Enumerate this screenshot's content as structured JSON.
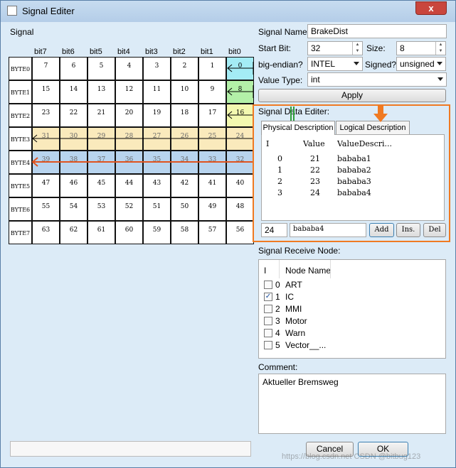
{
  "window": {
    "title": "Signal Editer",
    "close_glyph": "x"
  },
  "signal_group": {
    "label": "Signal"
  },
  "grid": {
    "columns": [
      "bit7",
      "bit6",
      "bit5",
      "bit4",
      "bit3",
      "bit2",
      "bit1",
      "bit0"
    ],
    "rows": [
      {
        "label": "BYTE0",
        "cells": [
          "7",
          "6",
          "5",
          "4",
          "3",
          "2",
          "1",
          "0"
        ]
      },
      {
        "label": "BYTE1",
        "cells": [
          "15",
          "14",
          "13",
          "12",
          "11",
          "10",
          "9",
          "8"
        ]
      },
      {
        "label": "BYTE2",
        "cells": [
          "23",
          "22",
          "21",
          "20",
          "19",
          "18",
          "17",
          "16"
        ]
      },
      {
        "label": "BYTE3",
        "cells": [
          "31",
          "30",
          "29",
          "28",
          "27",
          "26",
          "25",
          "24"
        ]
      },
      {
        "label": "BYTE4",
        "cells": [
          "39",
          "38",
          "37",
          "36",
          "35",
          "34",
          "33",
          "32"
        ]
      },
      {
        "label": "BYTE5",
        "cells": [
          "47",
          "46",
          "45",
          "44",
          "43",
          "42",
          "41",
          "40"
        ]
      },
      {
        "label": "BYTE6",
        "cells": [
          "55",
          "54",
          "53",
          "52",
          "51",
          "50",
          "49",
          "48"
        ]
      },
      {
        "label": "BYTE7",
        "cells": [
          "63",
          "62",
          "61",
          "60",
          "59",
          "58",
          "57",
          "56"
        ]
      }
    ],
    "colors": {
      "byte0": "#a4ecf5",
      "byte1": "#b3f0a8",
      "byte2": "#f3f8b0",
      "byte3": "#faeabc",
      "byte4": "#b8d4ee"
    }
  },
  "form": {
    "signal_name_label": "Signal Name:",
    "signal_name": "BrakeDist",
    "start_bit_label": "Start Bit:",
    "start_bit": "32",
    "size_label": "Size:",
    "size": "8",
    "big_endian_label": "big-endian?",
    "big_endian": "INTEL",
    "signed_label": "Signed?",
    "signed": "unsigned",
    "value_type_label": "Value Type:",
    "value_type": "int",
    "apply": "Apply"
  },
  "data_editor": {
    "label": "Signal Data Editer:",
    "tabs": [
      "Physical Description",
      "Logical  Description"
    ],
    "headers": [
      "I",
      "Value",
      "ValueDescri..."
    ],
    "rows": [
      {
        "i": "0",
        "value": "21",
        "desc": "bababa1"
      },
      {
        "i": "1",
        "value": "22",
        "desc": "bababa2"
      },
      {
        "i": "2",
        "value": "23",
        "desc": "bababa3"
      },
      {
        "i": "3",
        "value": "24",
        "desc": "bababa4"
      }
    ],
    "value_input": "24",
    "desc_input": "bababa4",
    "add": "Add",
    "ins": "Ins.",
    "del": "Del"
  },
  "receive": {
    "label": "Signal Receive Node:",
    "headers": [
      "I",
      "Node Name"
    ],
    "nodes": [
      {
        "i": "0",
        "name": "ART",
        "checked": false
      },
      {
        "i": "1",
        "name": "IC",
        "checked": true
      },
      {
        "i": "2",
        "name": "MMI",
        "checked": false
      },
      {
        "i": "3",
        "name": "Motor",
        "checked": false
      },
      {
        "i": "4",
        "name": "Warn",
        "checked": false
      },
      {
        "i": "5",
        "name": "Vector__...",
        "checked": false
      }
    ]
  },
  "comment": {
    "label": "Comment:",
    "text": "Aktueller Bremsweg"
  },
  "footer": {
    "cancel": "Cancel",
    "ok": "OK",
    "watermark": "https://blog.csdn.net  CSDN @bitbug123"
  },
  "annot_color": "#f07a22",
  "annot_green": "#2e9d3a"
}
